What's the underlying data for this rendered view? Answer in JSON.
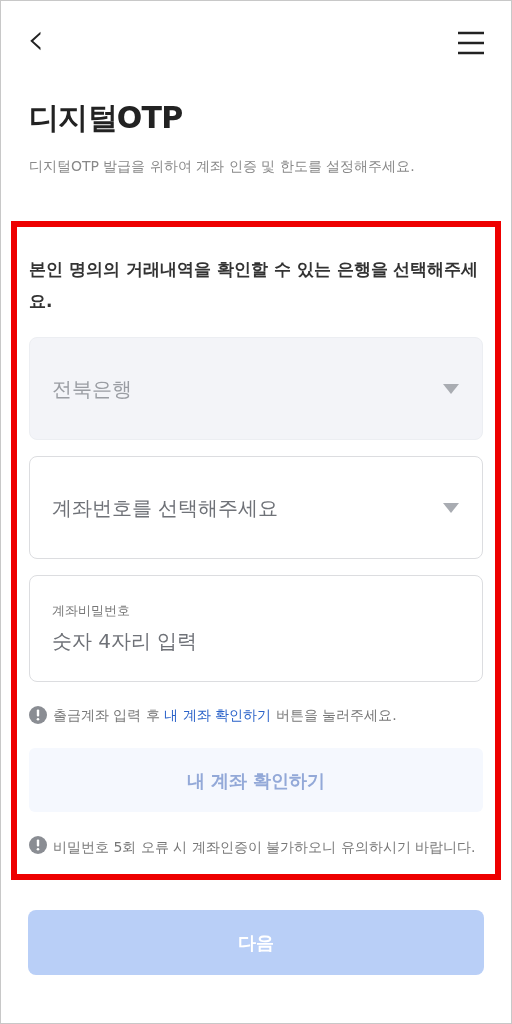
{
  "header": {
    "back": "‹"
  },
  "title": "디지털OTP",
  "subtitle": "디지털OTP 발급을 위하여 계좌 인증 및 한도를 설정해주세요.",
  "highlighted": true,
  "section": {
    "heading": "본인 명의의 거래내역을 확인할 수 있는 은행을 선택해주세요.",
    "selects": [
      {
        "value": "전북은행",
        "disabled": true
      },
      {
        "placeholder": "계좌번호를 선택해주세요",
        "disabled": false
      }
    ],
    "password_field": {
      "label": "계좌비밀번호",
      "placeholder": "숫자 4자리 입력"
    },
    "notice": {
      "before": "출금계좌 입력 후",
      "link": "내 계좌 확인하기",
      "after": "버튼을 눌러주세요."
    },
    "verify_button": {
      "label": "내 계좌 확인하기",
      "disabled": true
    },
    "warning": "비밀번호 5회 오류 시 계좌인증이 불가하오니 유의하시기 바랍니다."
  },
  "next_button": {
    "label": "다음",
    "disabled": true
  }
}
